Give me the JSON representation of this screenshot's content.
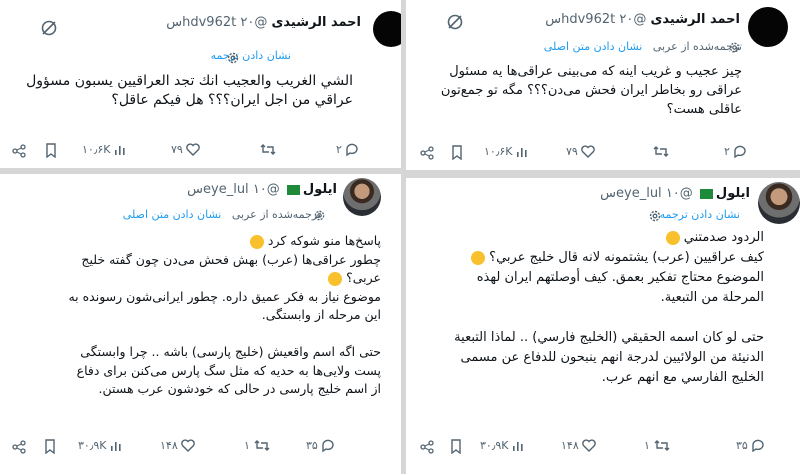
{
  "tweets": {
    "top_left": {
      "author_name": "احمد الرشیدی",
      "handle": "@hdv962t",
      "time": "۲۰س",
      "translate_link": "نشان دادن ترجمه",
      "text": [
        "الشي الغريب والعجيب انك تجد العراقيين يسبون مسؤول",
        "عراقي من اجل ايران؟؟؟ هل فيكم عاقل؟"
      ],
      "stats": {
        "replies": "۲",
        "reposts": "",
        "likes": "۷۹",
        "views": "۱۰٫۶K"
      }
    },
    "top_right": {
      "author_name": "احمد الرشیدی",
      "handle": "@hdv962t",
      "time": "۲۰س",
      "translation_note": "ترجمه‌شده از عربی",
      "original_link": "نشان دادن متن اصلی",
      "text": [
        "چیز عجیب و غریب اینه که می‌بینی عراقی‌ها یه مسئول",
        "عراقی رو بخاطر ایران فحش می‌دن؟؟؟ مگه تو جمع‌تون",
        "عاقلی هست؟"
      ],
      "stats": {
        "replies": "۲",
        "reposts": "",
        "likes": "۷۹",
        "views": "۱۰٫۶K"
      }
    },
    "bottom_left": {
      "author_name": "ایلول",
      "handle": "@eye_lul",
      "time": "۱۰س",
      "translation_note": "ترجمه‌شده از عربی",
      "original_link": "نشان دادن متن اصلی",
      "text": [
        "پاسخ‌ها منو شوکه کرد",
        "چطور عراقی‌ها (عرب) بهش فحش می‌دن چون گفته خلیج",
        "عربی؟",
        "موضوع نیاز به فکر عمیق داره. چطور ایرانی‌شون رسونده به",
        "این مرحله از وابستگی.",
        "",
        "حتی اگه اسم واقعیش (خلیج پارسی) باشه .. چرا وابستگی",
        "پست ولایی‌ها به حدیه که مثل سگ پارس می‌کنن برای دفاع",
        "از اسم خلیج پارسی در حالی که خودشون عرب هستن."
      ],
      "stats": {
        "replies": "۳۵",
        "reposts": "۱",
        "likes": "۱۴۸",
        "views": "۳۰٫۹K"
      }
    },
    "bottom_right": {
      "author_name": "ایلول",
      "handle": "@eye_lul",
      "time": "۱۰س",
      "translate_link": "نشان دادن ترجمه",
      "text": [
        "الردود صدمتني",
        "كيف عراقيين (عرب) يشتمونه لانه قال خليج عربي؟",
        "الموضوع محتاج تفكير بعمق. كيف أوصلتهم ايران لهذه",
        "المرحلة من التبعية.",
        "",
        "حتى لو كان اسمه الحقيقي (الخليج فارسي) .. لماذا التبعية",
        "الدنيئة من الولائيين لدرجة انهم ينبحون للدفاع عن مسمى",
        "الخليج الفارسي مع انهم عرب."
      ],
      "stats": {
        "replies": "۳۵",
        "reposts": "۱",
        "likes": "۱۴۸",
        "views": "۳۰٫۹K"
      }
    }
  },
  "colors": {
    "link": "#1d9bf0",
    "muted": "#536471",
    "text": "#0f1419",
    "flag": "#1f8b3a"
  }
}
